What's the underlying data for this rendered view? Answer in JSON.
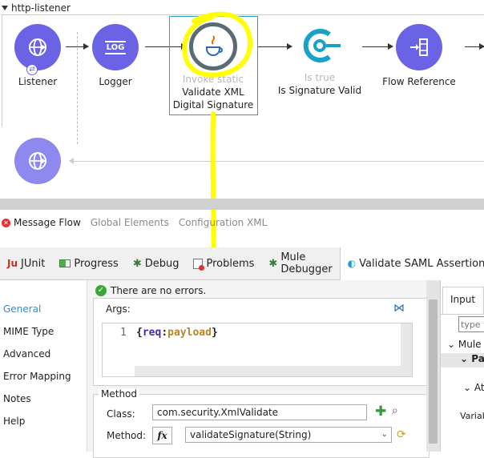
{
  "flow": {
    "title": "http-listener",
    "nodes": [
      {
        "label": "Listener"
      },
      {
        "label": "Logger",
        "icon_text": "LOG"
      },
      {
        "sublabel": "Invoke static",
        "label_line1": "Validate XML",
        "label_line2": "Digital Signature"
      },
      {
        "sublabel": "Is true",
        "label": "Is Signature Valid"
      },
      {
        "label": "Flow Reference"
      }
    ]
  },
  "editor_tabs": [
    "Message Flow",
    "Global Elements",
    "Configuration XML"
  ],
  "panel_tabs": [
    {
      "prefix": "Ju",
      "label": "JUnit"
    },
    {
      "label": "Progress"
    },
    {
      "label": "Debug"
    },
    {
      "label": "Problems"
    },
    {
      "label": "Mule Debugger"
    },
    {
      "label": "Validate SAML Assertion"
    }
  ],
  "nav": [
    "General",
    "MIME Type",
    "Advanced",
    "Error Mapping",
    "Notes",
    "Help"
  ],
  "status": "There are no errors.",
  "args": {
    "label": "Args:",
    "line_no": "1",
    "code_open": "{",
    "code_key": "req",
    "code_sep": ":",
    "code_val": "payload",
    "code_close": "}"
  },
  "method": {
    "section": "Method",
    "class_label": "Class:",
    "class_value": "com.security.XmlValidate",
    "method_label": "Method:",
    "fx": "fx",
    "method_value": "validateSignature(String)"
  },
  "right": {
    "tab": "Input",
    "search_placeholder": "type f",
    "tree1": "Mule",
    "tree2": "Pa",
    "tree3": "At",
    "tree4": "Variab"
  },
  "colors": {
    "node": "#6a63e6",
    "selection": "#2aa0c9",
    "annotation": "#ffff00",
    "nav_selected": "#2f8fd1"
  }
}
